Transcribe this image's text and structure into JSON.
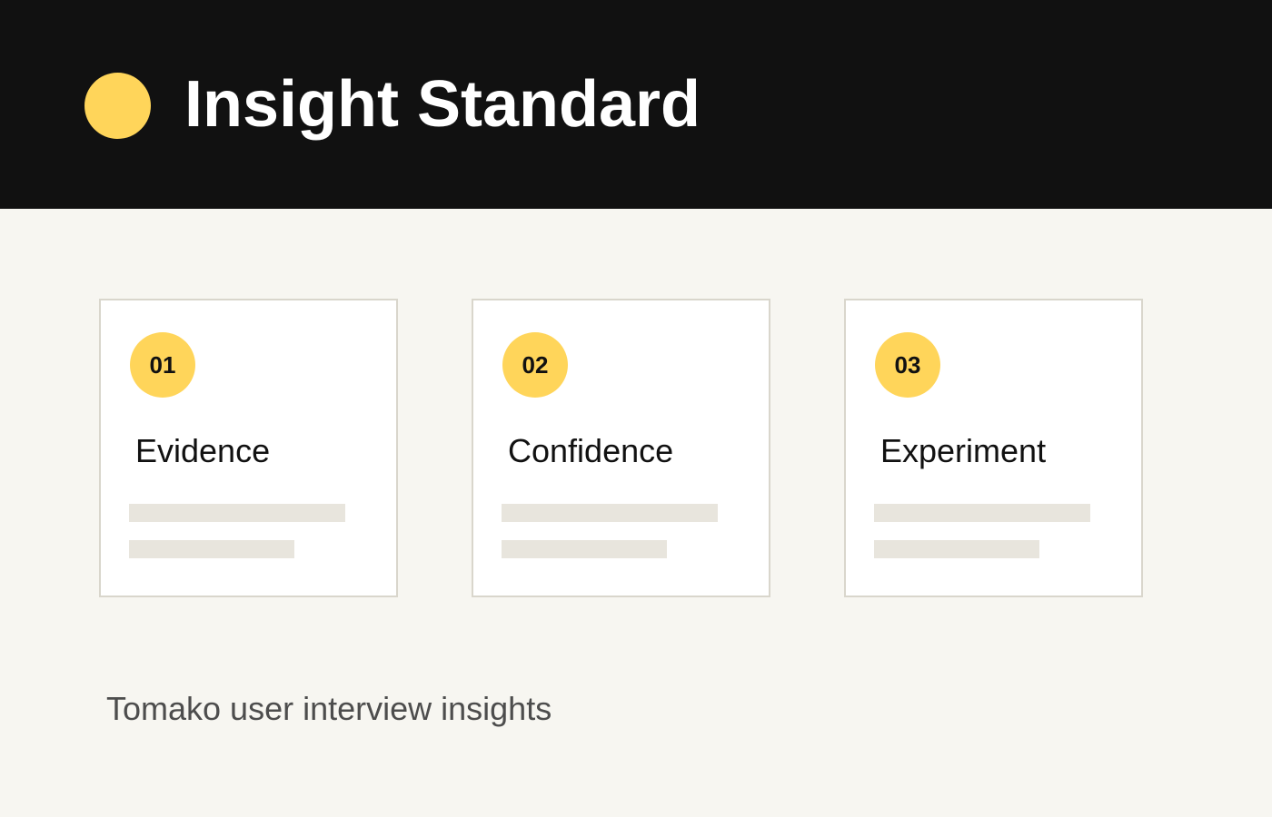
{
  "colors": {
    "header_background": "#111111",
    "accent": "#ffd55a",
    "page_background": "#f7f6f1",
    "card_border": "#d9d6cc",
    "placeholder_bar": "#e8e5dd"
  },
  "header": {
    "title": "Insight Standard",
    "icon": "yellow-dot-icon"
  },
  "cards": [
    {
      "number": "01",
      "title": "Evidence"
    },
    {
      "number": "02",
      "title": "Confidence"
    },
    {
      "number": "03",
      "title": "Experiment"
    }
  ],
  "footer": {
    "text": "Tomako user interview insights"
  }
}
